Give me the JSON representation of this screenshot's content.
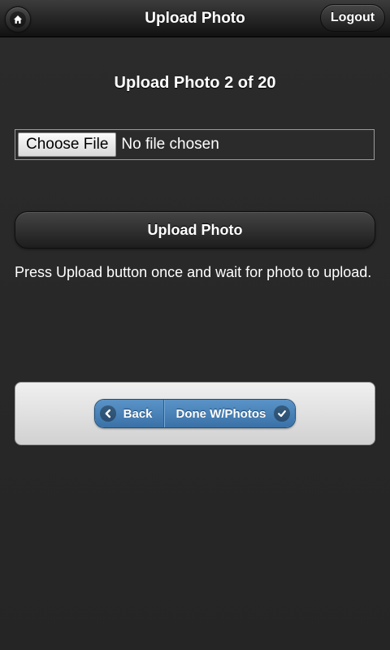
{
  "header": {
    "title": "Upload Photo",
    "logout_label": "Logout",
    "home_icon": "home-icon"
  },
  "main": {
    "heading": "Upload Photo 2 of 20",
    "file_input": {
      "button_label": "Choose File",
      "status_text": "No file chosen"
    },
    "upload_button_label": "Upload Photo",
    "instructions": "Press Upload button once and wait for photo to upload."
  },
  "nav": {
    "back_label": "Back",
    "back_icon": "chevron-left-icon",
    "done_label": "Done W/Photos",
    "done_icon": "checkmark-icon"
  },
  "colors": {
    "background": "#2a2a2a",
    "header": "#1e1e1e",
    "accent_blue": "#4a84bb",
    "panel": "#e0e0e0"
  }
}
